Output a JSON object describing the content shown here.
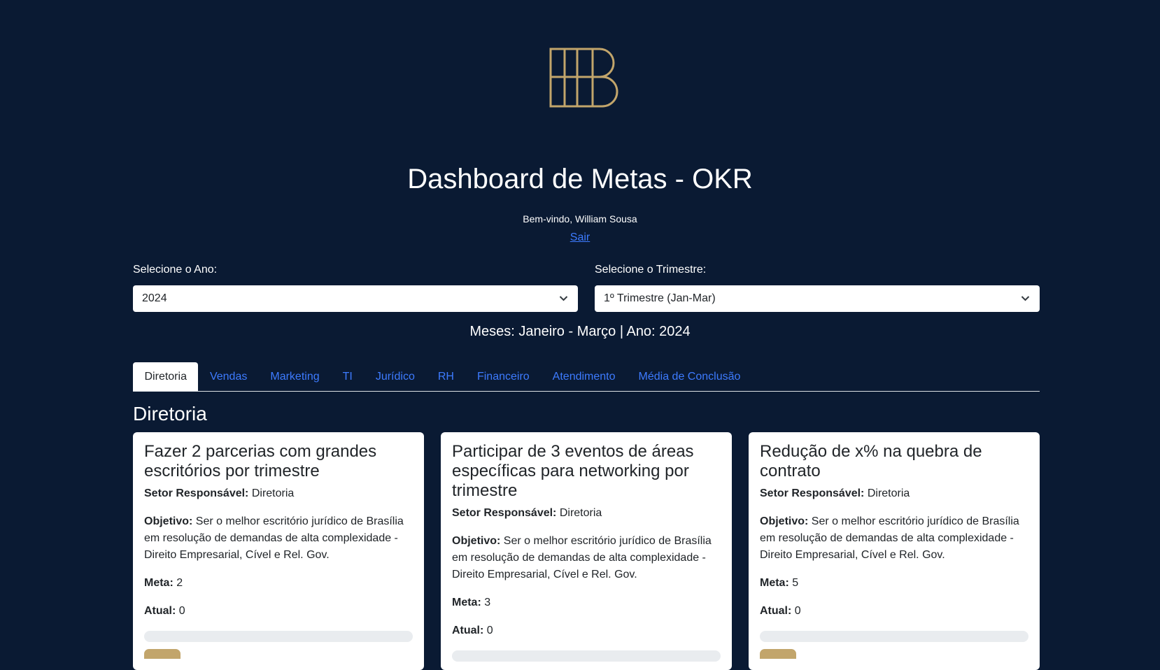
{
  "header": {
    "title": "Dashboard de Metas - OKR",
    "welcome": "Bem-vindo, William Sousa",
    "logout_label": "Sair",
    "logo_color": "#c2a56b"
  },
  "filters": {
    "year_label": "Selecione o Ano:",
    "year_value": "2024",
    "quarter_label": "Selecione o Trimestre:",
    "quarter_value": "1º Trimestre (Jan-Mar)"
  },
  "period_text": "Meses: Janeiro - Março | Ano: 2024",
  "tabs": [
    {
      "label": "Diretoria",
      "active": true
    },
    {
      "label": "Vendas"
    },
    {
      "label": "Marketing"
    },
    {
      "label": "TI"
    },
    {
      "label": "Jurídico"
    },
    {
      "label": "RH"
    },
    {
      "label": "Financeiro"
    },
    {
      "label": "Atendimento"
    },
    {
      "label": "Média de Conclusão"
    }
  ],
  "section_title": "Diretoria",
  "labels": {
    "sector": "Setor Responsável:",
    "objective": "Objetivo:",
    "goal": "Meta:",
    "current": "Atual:"
  },
  "cards": [
    {
      "title": "Fazer 2 parcerias com grandes escritórios por trimestre",
      "sector": "Diretoria",
      "objective": "Ser o melhor escritório jurídico de Brasília em resolução de demandas de alta complexidade - Direito Empresarial, Cível e Rel. Gov.",
      "goal": "2",
      "current": "0",
      "progress": 0
    },
    {
      "title": "Participar de 3 eventos de áreas específicas para networking por trimestre",
      "sector": "Diretoria",
      "objective": "Ser o melhor escritório jurídico de Brasília em resolução de demandas de alta complexidade - Direito Empresarial, Cível e Rel. Gov.",
      "goal": "3",
      "current": "0",
      "progress": 0
    },
    {
      "title": "Redução de x% na quebra de contrato",
      "sector": "Diretoria",
      "objective": "Ser o melhor escritório jurídico de Brasília em resolução de demandas de alta complexidade - Direito Empresarial, Cível e Rel. Gov.",
      "goal": "5",
      "current": "0",
      "progress": 0
    }
  ]
}
